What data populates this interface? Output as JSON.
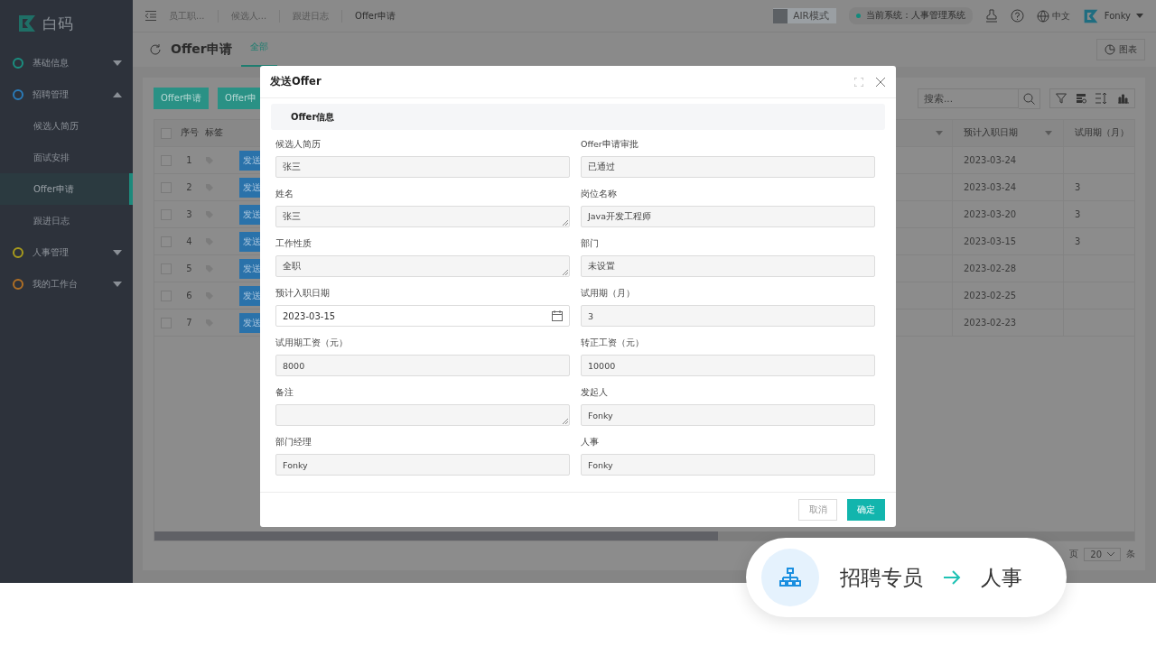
{
  "sidebar": {
    "logo_text": "白码",
    "groups": [
      {
        "label": "基础信息",
        "color": "#1a8f80",
        "expanded": false
      },
      {
        "label": "招聘管理",
        "color": "#2a7ab8",
        "expanded": true,
        "children": [
          {
            "label": "候选人简历",
            "selected": false
          },
          {
            "label": "面试安排",
            "selected": false
          },
          {
            "label": "Offer申请",
            "selected": true
          },
          {
            "label": "跟进日志",
            "selected": false
          }
        ]
      },
      {
        "label": "人事管理",
        "color": "#a79a1c",
        "expanded": false
      },
      {
        "label": "我的工作台",
        "color": "#b06f25",
        "expanded": false
      }
    ]
  },
  "topbar": {
    "tabs": [
      {
        "label": "员工职...",
        "selected": false
      },
      {
        "label": "候选人...",
        "selected": false
      },
      {
        "label": "跟进日志",
        "selected": false
      },
      {
        "label": "Offer申请",
        "selected": true
      }
    ],
    "air_mode": {
      "label": "AIR模式",
      "on": false
    },
    "system": "当前系统：人事管理系统",
    "language": "中文",
    "user": "Fonky"
  },
  "page": {
    "title": "Offer申请",
    "tabs": [
      {
        "label": "全部",
        "selected": true
      }
    ],
    "chart_button": "图表"
  },
  "toolbar": {
    "buttons": [
      "Offer申请",
      "Offer申"
    ],
    "search_placeholder": "搜索..."
  },
  "table": {
    "columns": [
      "序号",
      "标签",
      "预计入职日期",
      "试用期（月）"
    ],
    "all_checked": false,
    "rows": [
      {
        "checked": false,
        "index": "1",
        "action": "发送",
        "date": "2023-03-24"
      },
      {
        "checked": false,
        "index": "2",
        "action": "发送",
        "date": "2023-03-24",
        "trial": "3"
      },
      {
        "checked": false,
        "index": "3",
        "action": "发送",
        "date": "2023-03-20",
        "trial": "3"
      },
      {
        "checked": false,
        "index": "4",
        "action": "发送",
        "date": "2023-03-15",
        "trial": "3"
      },
      {
        "checked": false,
        "index": "5",
        "action": "发送",
        "date": "2023-02-28"
      },
      {
        "checked": false,
        "index": "6",
        "action": "发送",
        "date": "2023-02-25"
      },
      {
        "checked": false,
        "index": "7",
        "action": "发送",
        "date": "2023-02-23"
      }
    ],
    "pagination": {
      "before": "页",
      "page_size": "20",
      "after": "条"
    }
  },
  "modal": {
    "title": "发送Offer",
    "section": "Offer信息",
    "fields": [
      {
        "label": "候选人简历",
        "value": "张三",
        "kind": "text"
      },
      {
        "label": "Offer申请审批",
        "value": "已通过",
        "kind": "text"
      },
      {
        "label": "姓名",
        "value": "张三",
        "kind": "textarea"
      },
      {
        "label": "岗位名称",
        "value": "Java开发工程师",
        "kind": "text"
      },
      {
        "label": "工作性质",
        "value": "全职",
        "kind": "textarea"
      },
      {
        "label": "部门",
        "value": "未设置",
        "kind": "text"
      },
      {
        "label": "预计入职日期",
        "value": "2023-03-15",
        "kind": "date"
      },
      {
        "label": "试用期（月）",
        "value": "3",
        "kind": "text"
      },
      {
        "label": "试用期工资（元）",
        "value": "8000",
        "kind": "text"
      },
      {
        "label": "转正工资（元）",
        "value": "10000",
        "kind": "text"
      },
      {
        "label": "备注",
        "kind": "textarea"
      },
      {
        "label": "发起人",
        "value": "Fonky",
        "kind": "text"
      },
      {
        "label": "部门经理",
        "value": "Fonky",
        "kind": "text"
      },
      {
        "label": "人事",
        "value": "Fonky",
        "kind": "text"
      }
    ],
    "cancel": "取消",
    "confirm": "确定"
  },
  "callout": {
    "from": "招聘专员",
    "to": "人事"
  }
}
